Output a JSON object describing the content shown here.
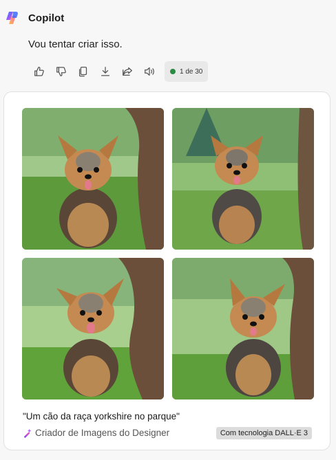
{
  "app": {
    "name": "Copilot",
    "logo_icon": "copilot-logo-icon"
  },
  "message": {
    "text": "Vou tentar criar isso."
  },
  "actions": {
    "icons": [
      "thumbs-up-icon",
      "thumbs-down-icon",
      "copy-icon",
      "download-icon",
      "share-icon",
      "read-aloud-icon"
    ],
    "counter_text": "1 de 30",
    "counter_dot_color": "#2a8a44"
  },
  "result": {
    "images": [
      {
        "alt_icon": "yorkshire-image-1"
      },
      {
        "alt_icon": "yorkshire-image-2"
      },
      {
        "alt_icon": "yorkshire-image-3"
      },
      {
        "alt_icon": "yorkshire-image-4"
      }
    ],
    "prompt_caption": "\"Um cão da raça yorkshire no parque\"",
    "creator_label": "Criador de Imagens do Designer",
    "creator_icon": "designer-wand-icon",
    "powered_by": "Com tecnologia DALL·E 3"
  }
}
